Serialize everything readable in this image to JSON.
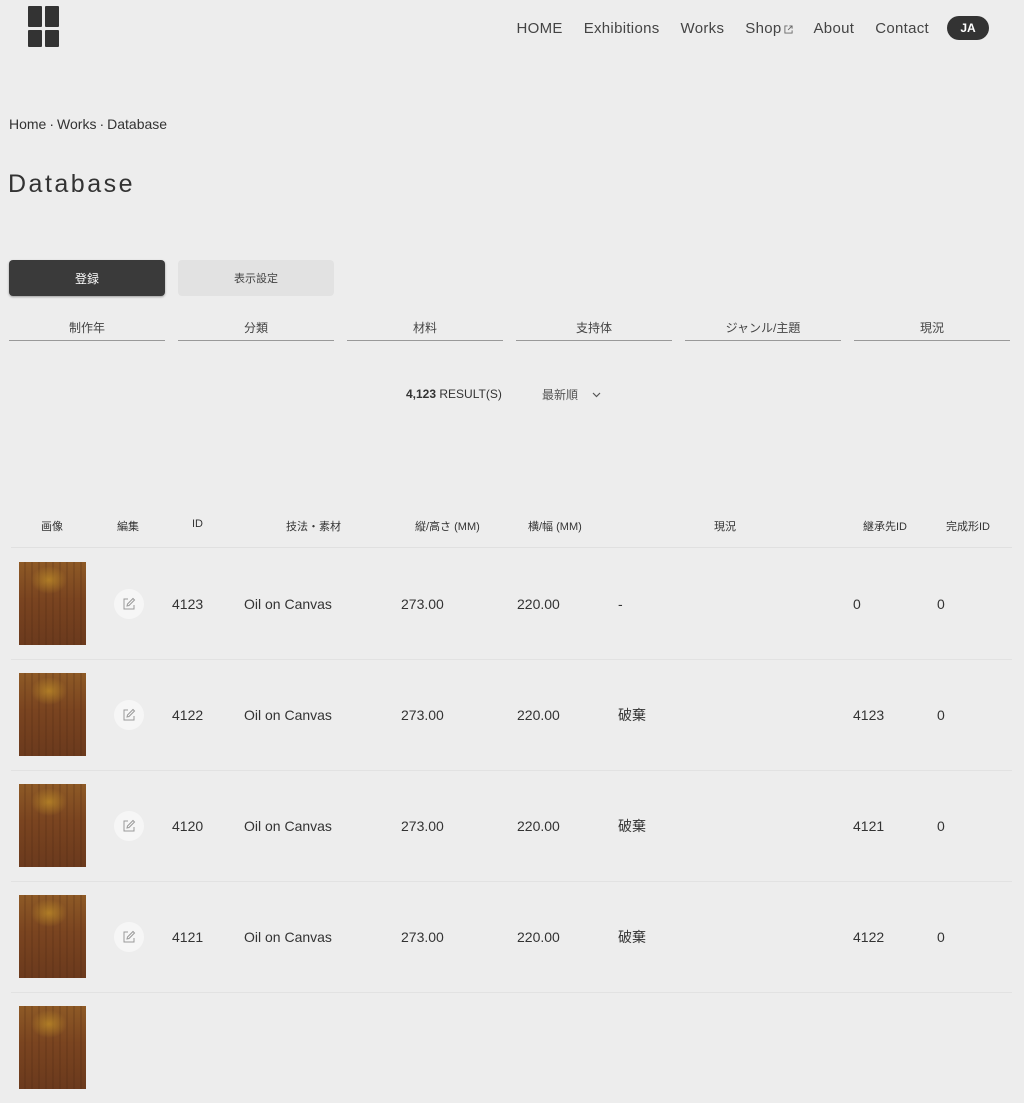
{
  "nav": {
    "items": [
      "HOME",
      "Exhibitions",
      "Works",
      "Shop",
      "About",
      "Contact"
    ],
    "language": "JA"
  },
  "breadcrumb": [
    "Home",
    "Works",
    "Database"
  ],
  "breadcrumb_separator": "·",
  "page_title": "Database",
  "buttons": {
    "register": "登録",
    "display_settings": "表示設定"
  },
  "filters": [
    "制作年",
    "分類",
    "材料",
    "支持体",
    "ジャンル/主題",
    "現況"
  ],
  "results": {
    "count": "4,123",
    "label": "RESULT(S)"
  },
  "sort": {
    "selected": "最新順"
  },
  "table": {
    "headers": [
      "画像",
      "編集",
      "ID",
      "技法・素材",
      "縦/高さ (MM)",
      "横/幅 (MM)",
      "現況",
      "継承先ID",
      "完成形ID"
    ],
    "rows": [
      {
        "id": "4123",
        "technique": "Oil on Canvas",
        "height": "273.00",
        "width": "220.00",
        "status": "-",
        "successor_id": "0",
        "final_id": "0"
      },
      {
        "id": "4122",
        "technique": "Oil on Canvas",
        "height": "273.00",
        "width": "220.00",
        "status": "破棄",
        "successor_id": "4123",
        "final_id": "0"
      },
      {
        "id": "4120",
        "technique": "Oil on Canvas",
        "height": "273.00",
        "width": "220.00",
        "status": "破棄",
        "successor_id": "4121",
        "final_id": "0"
      },
      {
        "id": "4121",
        "technique": "Oil on Canvas",
        "height": "273.00",
        "width": "220.00",
        "status": "破棄",
        "successor_id": "4122",
        "final_id": "0"
      }
    ]
  },
  "icons": {
    "logo": "grid-logo-icon",
    "external": "external-link-icon",
    "edit": "edit-icon",
    "chevron": "chevron-down-icon"
  },
  "colors": {
    "background": "#ededed",
    "text": "#333333",
    "primary_button": "#3a3a3a"
  }
}
